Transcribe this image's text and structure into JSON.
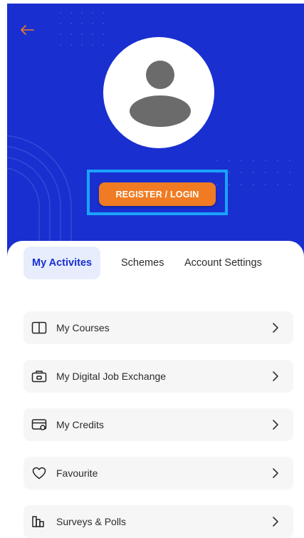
{
  "colors": {
    "header_bg": "#1a2fd0",
    "accent_orange": "#f07b22",
    "highlight_blue": "#1aa3ff",
    "active_tab_bg": "#e7edfd"
  },
  "header": {
    "back_icon": "arrow-left-icon",
    "avatar_icon": "user-avatar-icon",
    "login_label": "REGISTER / LOGIN"
  },
  "tabs": [
    {
      "label": "My Activites",
      "active": true
    },
    {
      "label": "Schemes",
      "active": false
    },
    {
      "label": "Account Settings",
      "active": false
    }
  ],
  "menu": [
    {
      "label": "My Courses",
      "icon": "book-icon"
    },
    {
      "label": "My Digital Job Exchange",
      "icon": "briefcase-icon"
    },
    {
      "label": "My Credits",
      "icon": "credit-card-icon"
    },
    {
      "label": "Favourite",
      "icon": "heart-icon"
    },
    {
      "label": "Surveys & Polls",
      "icon": "poll-icon"
    }
  ]
}
